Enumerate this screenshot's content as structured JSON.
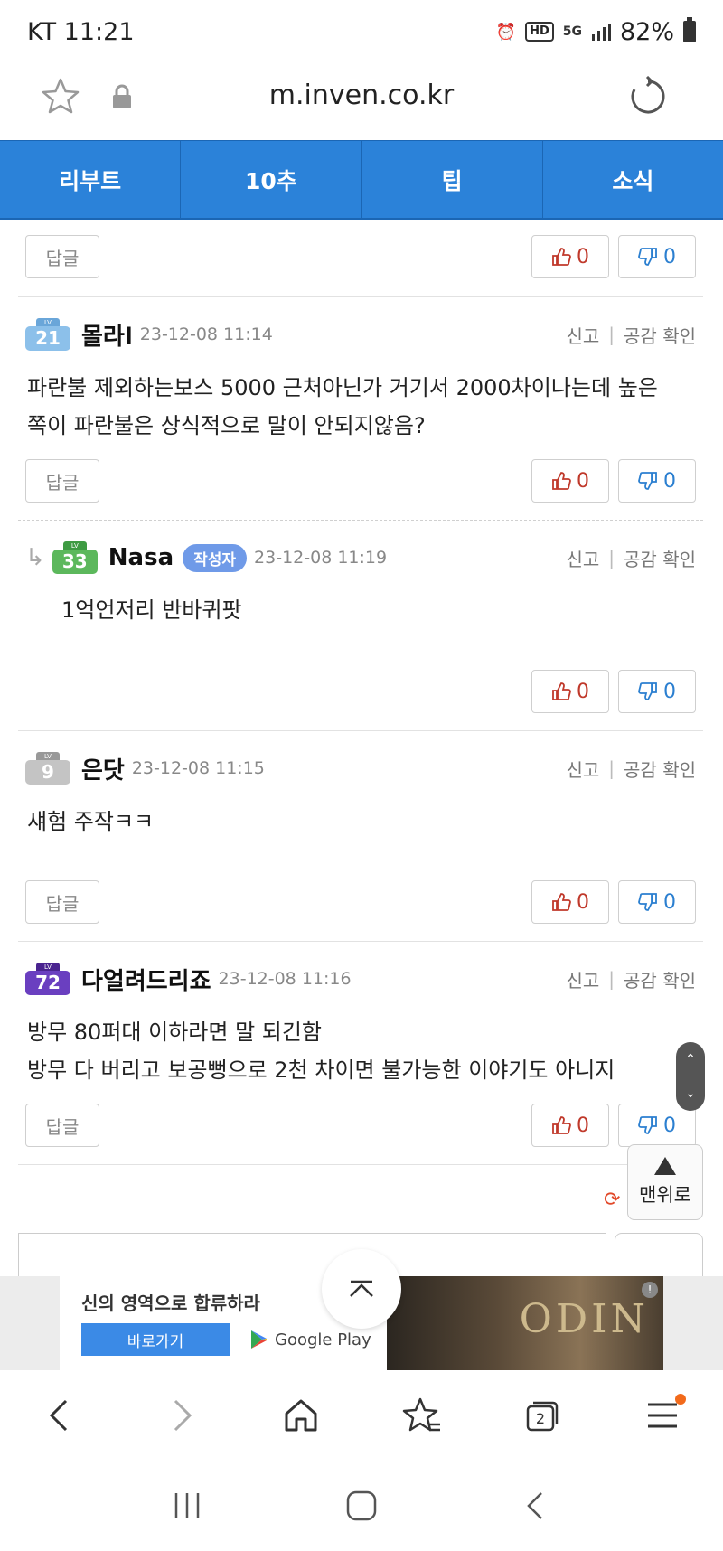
{
  "status_bar": {
    "carrier_time": "KT 11:21",
    "battery": "82%",
    "hd_badge": "HD",
    "network": "5G"
  },
  "url_bar": {
    "url": "m.inven.co.kr"
  },
  "tabs": [
    {
      "label": "리부트"
    },
    {
      "label": "10추"
    },
    {
      "label": "팁"
    },
    {
      "label": "소식"
    }
  ],
  "reply_label": "답글",
  "report_label": "신고",
  "empathy_label": "공감 확인",
  "author_badge": "작성자",
  "comments": [
    {
      "level": "21",
      "level_color": "#6aa6d9",
      "nick": "몰라l",
      "date": "23-12-08 11:14",
      "text": [
        "파란불 제외하는보스 5000 근처아닌가 거기서 2000차이나는데 높은",
        "쪽이 파란불은 상식적으로 말이 안되지않음?"
      ],
      "up": "0",
      "down": "0"
    },
    {
      "level": "33",
      "level_color": "#4caf50",
      "nick": "Nasa",
      "date": "23-12-08 11:19",
      "text": [
        "1억언저리 반바퀴팟"
      ],
      "up": "0",
      "down": "0",
      "is_reply": true
    },
    {
      "level": "9",
      "level_color": "#a9a9a9",
      "nick": "은닷",
      "date": "23-12-08 11:15",
      "text": [
        "섀험 주작ㅋㅋ"
      ],
      "up": "0",
      "down": "0"
    },
    {
      "level": "72",
      "level_color": "#5b2ea6",
      "nick": "다얼려드리죠",
      "date": "23-12-08 11:16",
      "text": [
        "방무 80퍼대 이하라면 말 되긴함",
        "방무 다 버리고 보공뻥으로 2천 차이면 불가능한 이야기도 아니지"
      ],
      "up": "0",
      "down": "0"
    }
  ],
  "previous_row": {
    "up": "0",
    "down": "0"
  },
  "lv_label": "LV",
  "top_button_label": "맨위로",
  "ad": {
    "title": "신의 영역으로 합류하라",
    "cta": "바로가기",
    "store": "Google Play",
    "logo": "ODIN"
  },
  "toolbar": {
    "tab_count": "2"
  }
}
